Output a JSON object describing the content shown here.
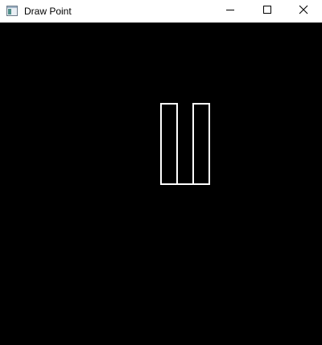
{
  "window": {
    "title": "Draw Point",
    "icon": "app-window-icon",
    "controls": [
      "minimize-icon",
      "maximize-icon",
      "close-icon"
    ]
  },
  "canvas": {
    "background": "#000000",
    "stroke_color": "#ffffff",
    "shapes": [
      {
        "type": "rectangle",
        "name": "left-bar"
      },
      {
        "type": "rectangle",
        "name": "right-bar"
      },
      {
        "type": "line",
        "name": "bottom-connector"
      }
    ]
  }
}
